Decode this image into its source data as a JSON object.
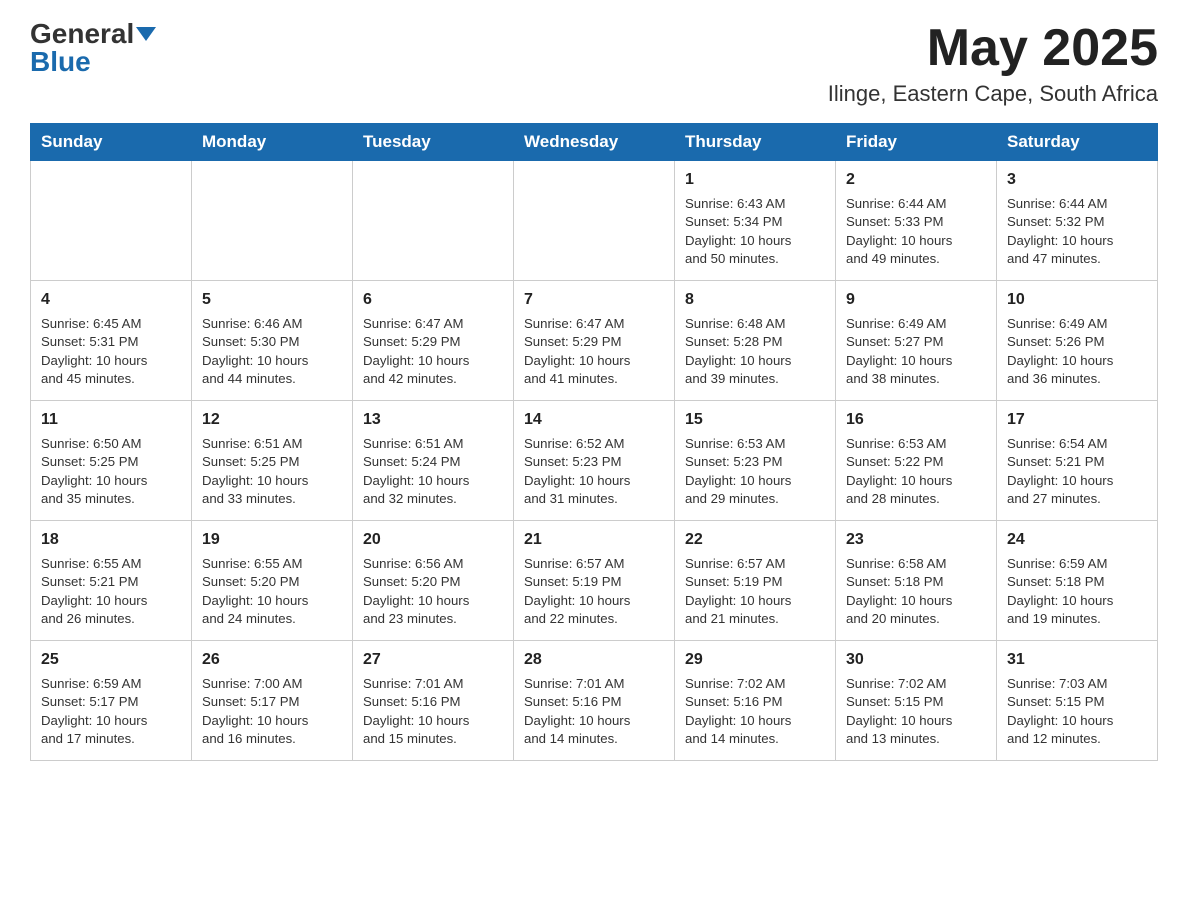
{
  "header": {
    "logo_general": "General",
    "logo_blue": "Blue",
    "month_title": "May 2025",
    "location": "Ilinge, Eastern Cape, South Africa"
  },
  "days_of_week": [
    "Sunday",
    "Monday",
    "Tuesday",
    "Wednesday",
    "Thursday",
    "Friday",
    "Saturday"
  ],
  "weeks": [
    [
      {
        "day": "",
        "info": ""
      },
      {
        "day": "",
        "info": ""
      },
      {
        "day": "",
        "info": ""
      },
      {
        "day": "",
        "info": ""
      },
      {
        "day": "1",
        "info": "Sunrise: 6:43 AM\nSunset: 5:34 PM\nDaylight: 10 hours\nand 50 minutes."
      },
      {
        "day": "2",
        "info": "Sunrise: 6:44 AM\nSunset: 5:33 PM\nDaylight: 10 hours\nand 49 minutes."
      },
      {
        "day": "3",
        "info": "Sunrise: 6:44 AM\nSunset: 5:32 PM\nDaylight: 10 hours\nand 47 minutes."
      }
    ],
    [
      {
        "day": "4",
        "info": "Sunrise: 6:45 AM\nSunset: 5:31 PM\nDaylight: 10 hours\nand 45 minutes."
      },
      {
        "day": "5",
        "info": "Sunrise: 6:46 AM\nSunset: 5:30 PM\nDaylight: 10 hours\nand 44 minutes."
      },
      {
        "day": "6",
        "info": "Sunrise: 6:47 AM\nSunset: 5:29 PM\nDaylight: 10 hours\nand 42 minutes."
      },
      {
        "day": "7",
        "info": "Sunrise: 6:47 AM\nSunset: 5:29 PM\nDaylight: 10 hours\nand 41 minutes."
      },
      {
        "day": "8",
        "info": "Sunrise: 6:48 AM\nSunset: 5:28 PM\nDaylight: 10 hours\nand 39 minutes."
      },
      {
        "day": "9",
        "info": "Sunrise: 6:49 AM\nSunset: 5:27 PM\nDaylight: 10 hours\nand 38 minutes."
      },
      {
        "day": "10",
        "info": "Sunrise: 6:49 AM\nSunset: 5:26 PM\nDaylight: 10 hours\nand 36 minutes."
      }
    ],
    [
      {
        "day": "11",
        "info": "Sunrise: 6:50 AM\nSunset: 5:25 PM\nDaylight: 10 hours\nand 35 minutes."
      },
      {
        "day": "12",
        "info": "Sunrise: 6:51 AM\nSunset: 5:25 PM\nDaylight: 10 hours\nand 33 minutes."
      },
      {
        "day": "13",
        "info": "Sunrise: 6:51 AM\nSunset: 5:24 PM\nDaylight: 10 hours\nand 32 minutes."
      },
      {
        "day": "14",
        "info": "Sunrise: 6:52 AM\nSunset: 5:23 PM\nDaylight: 10 hours\nand 31 minutes."
      },
      {
        "day": "15",
        "info": "Sunrise: 6:53 AM\nSunset: 5:23 PM\nDaylight: 10 hours\nand 29 minutes."
      },
      {
        "day": "16",
        "info": "Sunrise: 6:53 AM\nSunset: 5:22 PM\nDaylight: 10 hours\nand 28 minutes."
      },
      {
        "day": "17",
        "info": "Sunrise: 6:54 AM\nSunset: 5:21 PM\nDaylight: 10 hours\nand 27 minutes."
      }
    ],
    [
      {
        "day": "18",
        "info": "Sunrise: 6:55 AM\nSunset: 5:21 PM\nDaylight: 10 hours\nand 26 minutes."
      },
      {
        "day": "19",
        "info": "Sunrise: 6:55 AM\nSunset: 5:20 PM\nDaylight: 10 hours\nand 24 minutes."
      },
      {
        "day": "20",
        "info": "Sunrise: 6:56 AM\nSunset: 5:20 PM\nDaylight: 10 hours\nand 23 minutes."
      },
      {
        "day": "21",
        "info": "Sunrise: 6:57 AM\nSunset: 5:19 PM\nDaylight: 10 hours\nand 22 minutes."
      },
      {
        "day": "22",
        "info": "Sunrise: 6:57 AM\nSunset: 5:19 PM\nDaylight: 10 hours\nand 21 minutes."
      },
      {
        "day": "23",
        "info": "Sunrise: 6:58 AM\nSunset: 5:18 PM\nDaylight: 10 hours\nand 20 minutes."
      },
      {
        "day": "24",
        "info": "Sunrise: 6:59 AM\nSunset: 5:18 PM\nDaylight: 10 hours\nand 19 minutes."
      }
    ],
    [
      {
        "day": "25",
        "info": "Sunrise: 6:59 AM\nSunset: 5:17 PM\nDaylight: 10 hours\nand 17 minutes."
      },
      {
        "day": "26",
        "info": "Sunrise: 7:00 AM\nSunset: 5:17 PM\nDaylight: 10 hours\nand 16 minutes."
      },
      {
        "day": "27",
        "info": "Sunrise: 7:01 AM\nSunset: 5:16 PM\nDaylight: 10 hours\nand 15 minutes."
      },
      {
        "day": "28",
        "info": "Sunrise: 7:01 AM\nSunset: 5:16 PM\nDaylight: 10 hours\nand 14 minutes."
      },
      {
        "day": "29",
        "info": "Sunrise: 7:02 AM\nSunset: 5:16 PM\nDaylight: 10 hours\nand 14 minutes."
      },
      {
        "day": "30",
        "info": "Sunrise: 7:02 AM\nSunset: 5:15 PM\nDaylight: 10 hours\nand 13 minutes."
      },
      {
        "day": "31",
        "info": "Sunrise: 7:03 AM\nSunset: 5:15 PM\nDaylight: 10 hours\nand 12 minutes."
      }
    ]
  ]
}
